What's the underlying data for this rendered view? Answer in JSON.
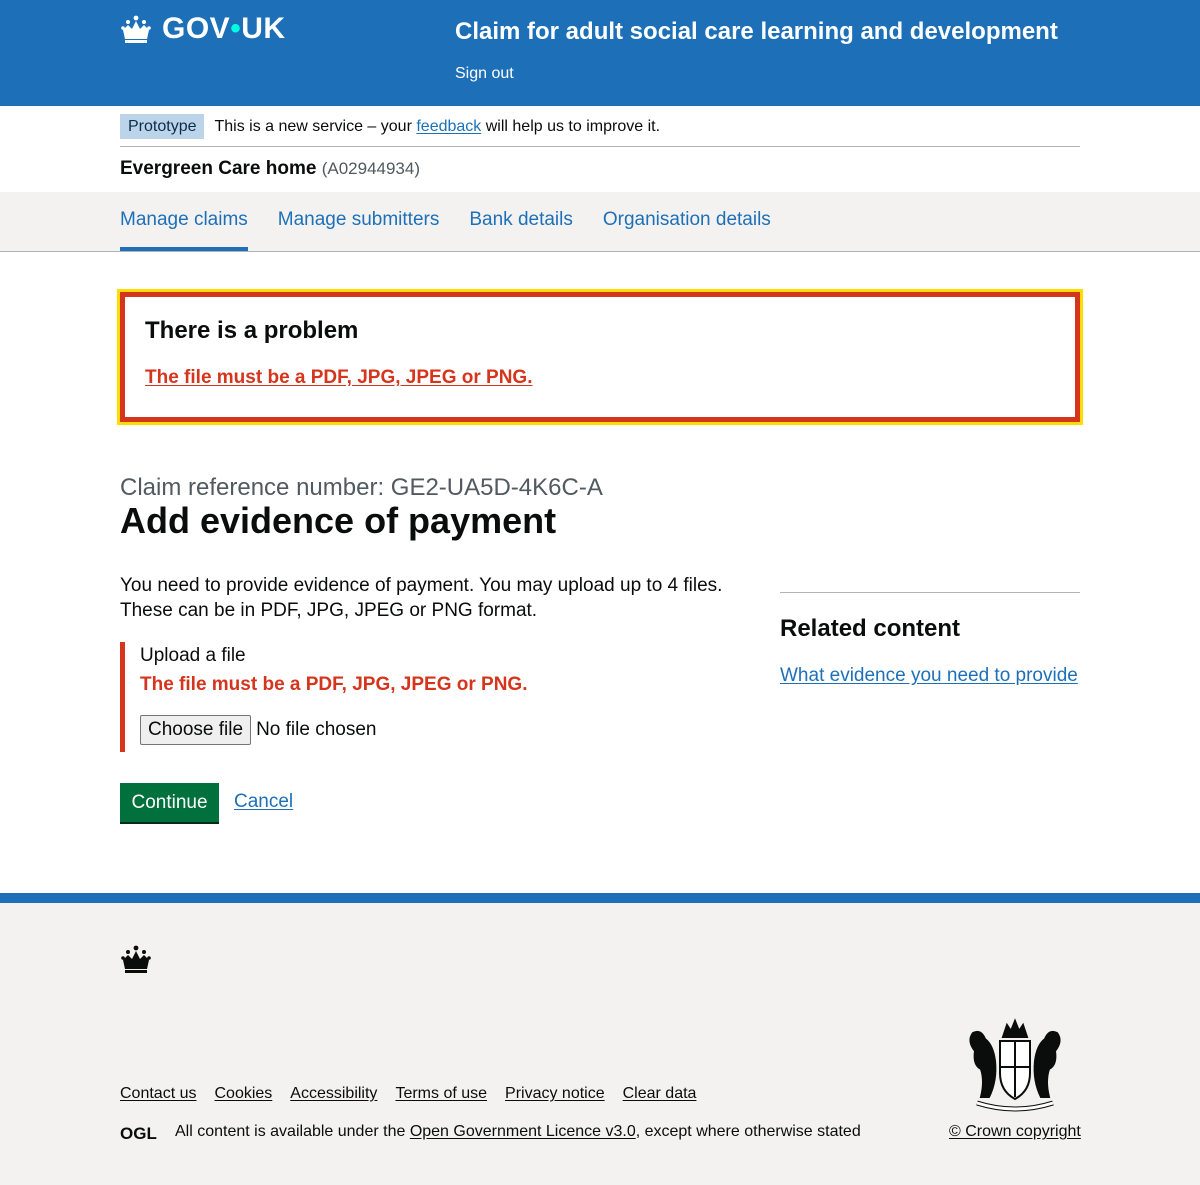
{
  "header": {
    "logo_text": "GOV",
    "logo_dot": "•",
    "logo_text2": "UK",
    "service_name": "Claim for adult social care learning and development",
    "sign_out": "Sign out",
    "crown_icon": "crown-icon"
  },
  "phase_banner": {
    "tag": "Prototype",
    "text_before": "This is a new service – your ",
    "feedback_link": "feedback",
    "text_after": " will help us to improve it."
  },
  "organisation": {
    "name": "Evergreen Care home",
    "id": "(A02944934)"
  },
  "subnav": {
    "items": [
      {
        "label": "Manage claims",
        "active": true
      },
      {
        "label": "Manage submitters",
        "active": false
      },
      {
        "label": "Bank details",
        "active": false
      },
      {
        "label": "Organisation details",
        "active": false
      }
    ]
  },
  "error_summary": {
    "title": "There is a problem",
    "error_link": "The file must be a PDF, JPG, JPEG or PNG."
  },
  "main": {
    "caption": "Claim reference number: GE2-UA5D-4K6C-A",
    "title": "Add evidence of payment",
    "intro": "You need to provide evidence of payment. You may upload up to 4 files. These can be in PDF, JPG, JPEG or PNG format.",
    "upload_label": "Upload a file",
    "upload_error": "The file must be a PDF, JPG, JPEG or PNG.",
    "choose_file": "Choose file",
    "file_status": "No file chosen",
    "continue": "Continue",
    "cancel": "Cancel"
  },
  "related": {
    "title": "Related content",
    "link": "What evidence you need to provide"
  },
  "footer": {
    "links": [
      "Contact us",
      "Cookies",
      "Accessibility",
      "Terms of use",
      "Privacy notice",
      "Clear data"
    ],
    "licence_before": "All content is available under the ",
    "licence_link": "Open Government Licence v3.0",
    "licence_after": ", except where otherwise stated",
    "copyright": "© Crown copyright",
    "ogl_logo": "OGL"
  },
  "colors": {
    "brand_blue": "#1d70b8",
    "error_red": "#d4351c",
    "focus_yellow": "#ffdd00",
    "button_green": "#00703c"
  }
}
